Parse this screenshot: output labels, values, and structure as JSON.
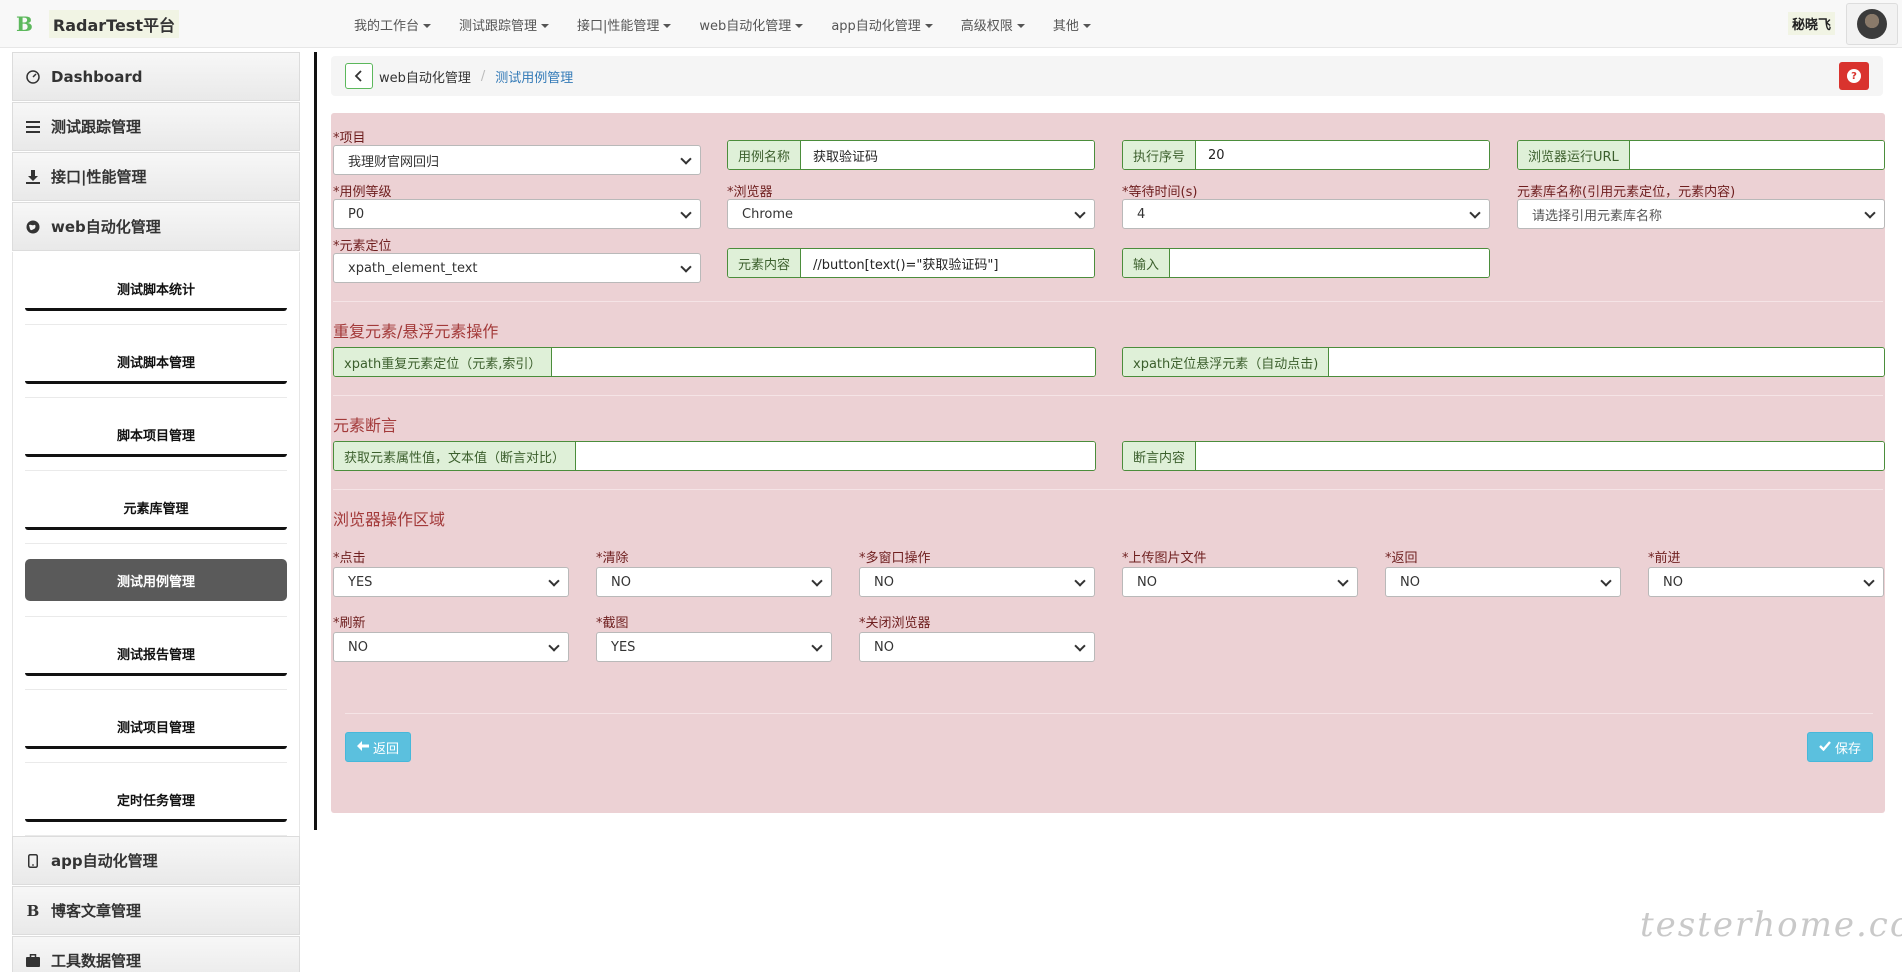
{
  "navbar": {
    "brand_logo": "B",
    "brand_name": "RadarTest平台",
    "items": [
      "我的工作台",
      "测试跟踪管理",
      "接口|性能管理",
      "web自动化管理",
      "app自动化管理",
      "高级权限",
      "其他"
    ],
    "user_name": "秘晓飞"
  },
  "sidebar": {
    "sections": [
      {
        "label": "Dashboard",
        "icon": "dashboard-icon"
      },
      {
        "label": "测试跟踪管理",
        "icon": "list-icon"
      },
      {
        "label": "接口|性能管理",
        "icon": "download-icon"
      },
      {
        "label": "web自动化管理",
        "icon": "globe-icon"
      }
    ],
    "web_sub_items": [
      "测试脚本统计",
      "测试脚本管理",
      "脚本项目管理",
      "元素库管理",
      "测试用例管理",
      "测试报告管理",
      "测试项目管理",
      "定时任务管理"
    ],
    "active_sub_item": "测试用例管理",
    "bottom_sections": [
      {
        "label": "app自动化管理",
        "icon": "mobile-icon"
      },
      {
        "label": "博客文章管理",
        "icon": "bold-icon"
      },
      {
        "label": "工具数据管理",
        "icon": "briefcase-icon"
      }
    ]
  },
  "breadcrumb": {
    "parent": "web自动化管理",
    "current": "测试用例管理"
  },
  "form": {
    "project": {
      "label": "*项目",
      "value": "我理财官网回归"
    },
    "case_name": {
      "addon": "用例名称",
      "value": "获取验证码"
    },
    "exec_order": {
      "addon": "执行序号",
      "value": "20"
    },
    "browser_url": {
      "addon": "浏览器运行URL",
      "value": ""
    },
    "case_level": {
      "label": "*用例等级",
      "value": "P0"
    },
    "browser": {
      "label": "*浏览器",
      "value": "Chrome"
    },
    "wait_time": {
      "label": "*等待时间(s)",
      "value": "4"
    },
    "element_lib": {
      "label": "元素库名称(引用元素定位，元素内容)",
      "placeholder": "请选择引用元素库名称"
    },
    "element_locate": {
      "label": "*元素定位",
      "value": "xpath_element_text"
    },
    "element_content": {
      "addon": "元素内容",
      "value": "//button[text()=\"获取验证码\"]"
    },
    "input": {
      "addon": "输入",
      "value": ""
    }
  },
  "repeat_section": {
    "title": "重复元素/悬浮元素操作",
    "xpath_repeat": {
      "addon": "xpath重复元素定位（元素,索引）",
      "value": ""
    },
    "xpath_hover": {
      "addon": "xpath定位悬浮元素（自动点击)",
      "value": ""
    }
  },
  "assert_section": {
    "title": "元素断言",
    "get_attr": {
      "addon": "获取元素属性值，文本值（断言对比）",
      "value": ""
    },
    "assert_content": {
      "addon": "断言内容",
      "value": ""
    }
  },
  "browser_section": {
    "title": "浏览器操作区域",
    "fields": [
      {
        "label": "*点击",
        "value": "YES"
      },
      {
        "label": "*清除",
        "value": "NO"
      },
      {
        "label": "*多窗口操作",
        "value": "NO"
      },
      {
        "label": "*上传图片文件",
        "value": "NO"
      },
      {
        "label": "*返回",
        "value": "NO"
      },
      {
        "label": "*前进",
        "value": "NO"
      },
      {
        "label": "*刷新",
        "value": "NO"
      },
      {
        "label": "*截图",
        "value": "YES"
      },
      {
        "label": "*关闭浏览器",
        "value": "NO"
      }
    ]
  },
  "buttons": {
    "back_label": "返回",
    "save_label": "保存"
  },
  "watermark": "testerhome.com"
}
